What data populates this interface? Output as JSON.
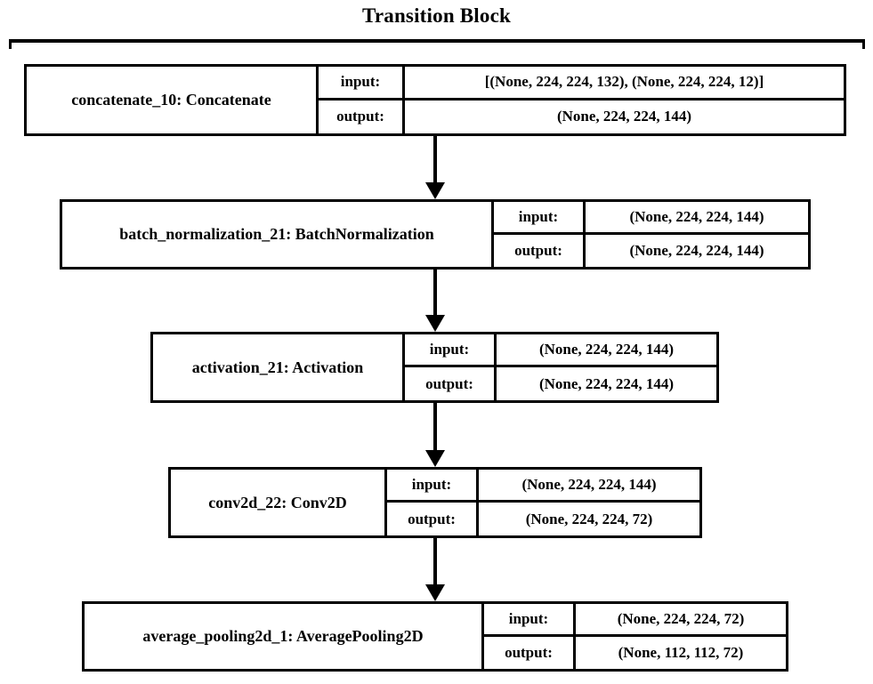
{
  "diagram": {
    "title": "Transition Block",
    "io_labels": {
      "input": "input:",
      "output": "output:"
    },
    "nodes": [
      {
        "id": "concatenate_10",
        "name": "concatenate_10: Concatenate",
        "input": "[(None, 224, 224, 132), (None, 224, 224, 12)]",
        "output": "(None, 224, 224, 144)"
      },
      {
        "id": "batch_normalization_21",
        "name": "batch_normalization_21: BatchNormalization",
        "input": "(None, 224, 224, 144)",
        "output": "(None, 224, 224, 144)"
      },
      {
        "id": "activation_21",
        "name": "activation_21: Activation",
        "input": "(None, 224, 224, 144)",
        "output": "(None, 224, 224, 144)"
      },
      {
        "id": "conv2d_22",
        "name": "conv2d_22: Conv2D",
        "input": "(None, 224, 224, 144)",
        "output": "(None, 224, 224, 72)"
      },
      {
        "id": "average_pooling2d_1",
        "name": "average_pooling2d_1: AveragePooling2D",
        "input": "(None, 224, 224, 72)",
        "output": "(None, 112, 112, 72)"
      }
    ],
    "edges": [
      {
        "from": "concatenate_10",
        "to": "batch_normalization_21"
      },
      {
        "from": "batch_normalization_21",
        "to": "activation_21"
      },
      {
        "from": "activation_21",
        "to": "conv2d_22"
      },
      {
        "from": "conv2d_22",
        "to": "average_pooling2d_1"
      }
    ],
    "colors": {
      "stroke": "#000000",
      "background": "#ffffff"
    }
  }
}
